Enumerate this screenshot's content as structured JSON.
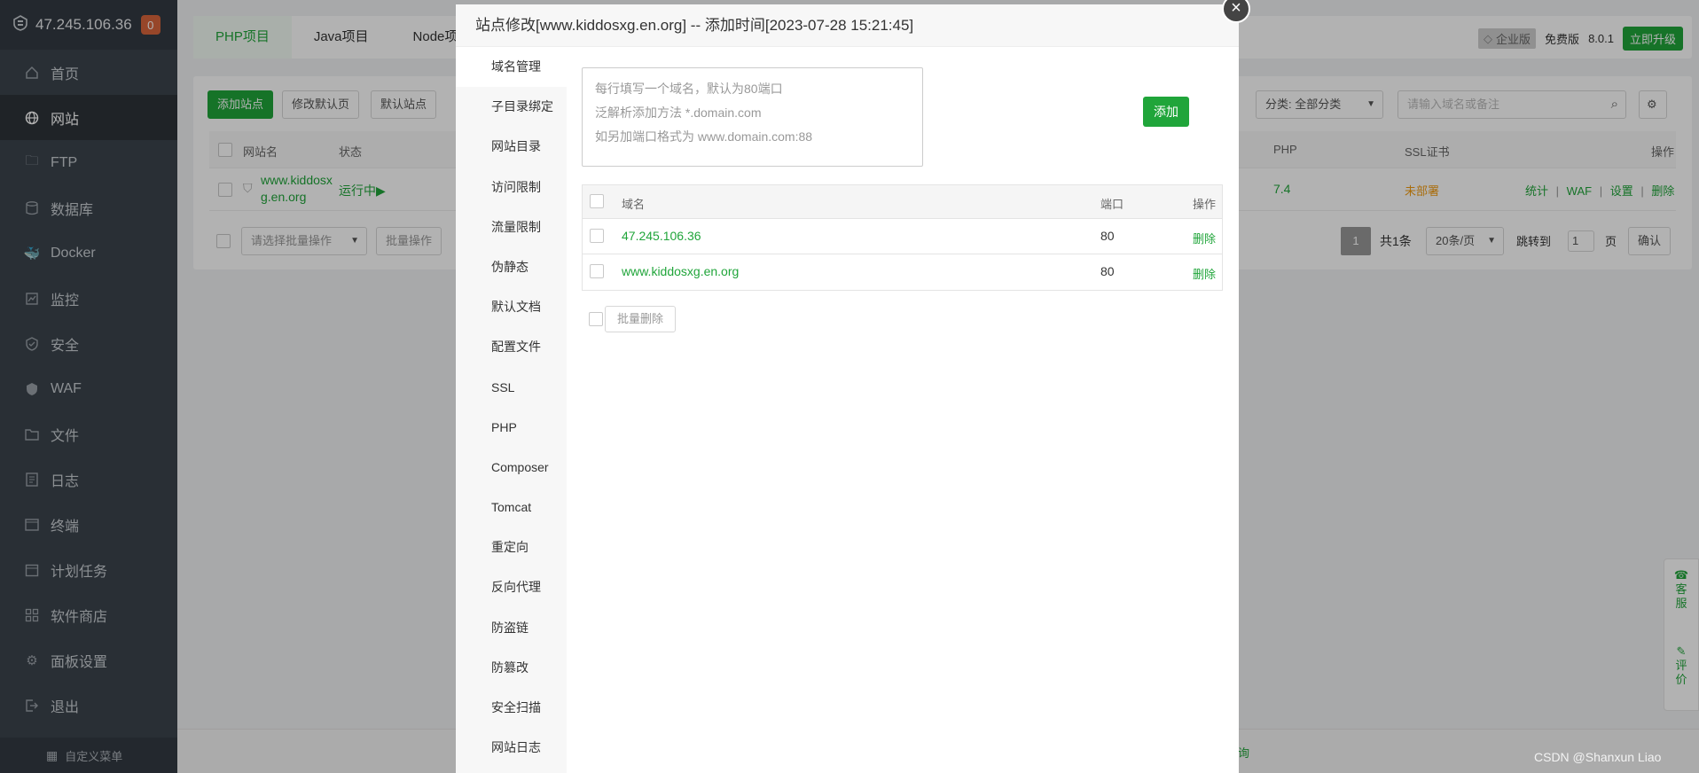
{
  "sidebar": {
    "ip": "47.245.106.36",
    "badge": "0",
    "items": [
      {
        "label": "首页",
        "icon": "home-icon"
      },
      {
        "label": "网站",
        "icon": "globe-icon",
        "active": true
      },
      {
        "label": "FTP",
        "icon": "ftp-icon"
      },
      {
        "label": "数据库",
        "icon": "database-icon"
      },
      {
        "label": "Docker",
        "icon": "docker-icon"
      },
      {
        "label": "监控",
        "icon": "monitor-icon"
      },
      {
        "label": "安全",
        "icon": "shield-icon"
      },
      {
        "label": "WAF",
        "icon": "waf-icon"
      },
      {
        "label": "文件",
        "icon": "folder-icon"
      },
      {
        "label": "日志",
        "icon": "log-icon"
      },
      {
        "label": "终端",
        "icon": "terminal-icon"
      },
      {
        "label": "计划任务",
        "icon": "calendar-icon"
      },
      {
        "label": "软件商店",
        "icon": "apps-icon"
      },
      {
        "label": "面板设置",
        "icon": "gear-icon"
      },
      {
        "label": "退出",
        "icon": "logout-icon"
      }
    ],
    "footer": "自定义菜单"
  },
  "topbar": {
    "tabs": [
      "PHP项目",
      "Java项目",
      "Node项"
    ],
    "enterprise": "企业版",
    "free": "免费版",
    "version": "8.0.1",
    "upgrade": "立即升级"
  },
  "sites": {
    "buttons": {
      "add_site": "添加站点",
      "edit_default": "修改默认页",
      "default_site": "默认站点"
    },
    "category": "分类: 全部分类",
    "search_placeholder": "请输入域名或备注",
    "headers": {
      "name": "网站名",
      "status": "状态",
      "php": "PHP",
      "ssl": "SSL证书",
      "ops": "操作"
    },
    "row": {
      "name_line1": "www.kiddosx",
      "name_line2": "g.en.org",
      "status": "运行中▶",
      "php": "7.4",
      "ssl": "未部署",
      "op_stats": "统计",
      "op_waf": "WAF",
      "op_settings": "设置",
      "op_delete": "删除",
      "sep": "|"
    },
    "batch_placeholder": "请选择批量操作",
    "batch_button": "批量操作",
    "pagination": {
      "current": "1",
      "total": "共1条",
      "per_page": "20条/页",
      "jump_label": "跳转到",
      "jump_value": "1",
      "page_unit": "页",
      "confirm": "确认"
    }
  },
  "float": {
    "service": "客\n服",
    "review": "评\n价"
  },
  "bottom_link": "询",
  "watermark": "CSDN @Shanxun Liao",
  "modal": {
    "title": "站点修改[www.kiddosxg.en.org] -- 添加时间[2023-07-28 15:21:45]",
    "close": "×",
    "nav": [
      "域名管理",
      "子目录绑定",
      "网站目录",
      "访问限制",
      "流量限制",
      "伪静态",
      "默认文档",
      "配置文件",
      "SSL",
      "PHP",
      "Composer",
      "Tomcat",
      "重定向",
      "反向代理",
      "防盗链",
      "防篡改",
      "安全扫描",
      "网站日志"
    ],
    "textarea_lines": [
      "每行填写一个域名，默认为80端口",
      "泛解析添加方法 *.domain.com",
      "如另加端口格式为 www.domain.com:88"
    ],
    "add_button": "添加",
    "table_headers": {
      "domain": "域名",
      "port": "端口",
      "ops": "操作"
    },
    "domains": [
      {
        "domain": "47.245.106.36",
        "port": "80",
        "op": "删除"
      },
      {
        "domain": "www.kiddosxg.en.org",
        "port": "80",
        "op": "删除"
      }
    ],
    "bulk_delete": "批量删除"
  }
}
